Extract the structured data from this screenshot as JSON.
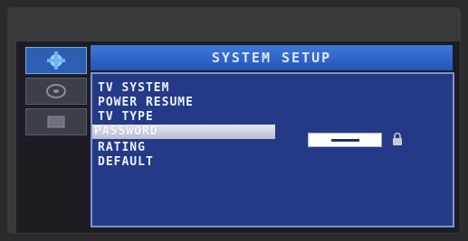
{
  "header": {
    "title": "SYSTEM SETUP"
  },
  "menu": {
    "items": [
      {
        "label": "TV SYSTEM",
        "selected": false
      },
      {
        "label": "POWER RESUME",
        "selected": false
      },
      {
        "label": "TV TYPE",
        "selected": false
      },
      {
        "label": "PASSWORD",
        "selected": true
      },
      {
        "label": "RATING",
        "selected": false
      },
      {
        "label": "DEFAULT",
        "selected": false
      }
    ]
  },
  "password": {
    "masked_value": "▬▬▬▬▬▬"
  },
  "sidebar": {
    "icons": [
      {
        "name": "setup-tools-icon",
        "active": true
      },
      {
        "name": "audio-disc-icon",
        "active": false
      },
      {
        "name": "video-screen-icon",
        "active": false
      }
    ]
  },
  "colors": {
    "accent": "#2f66c8",
    "panel": "#243a86",
    "highlight": "#e8e8f0"
  }
}
